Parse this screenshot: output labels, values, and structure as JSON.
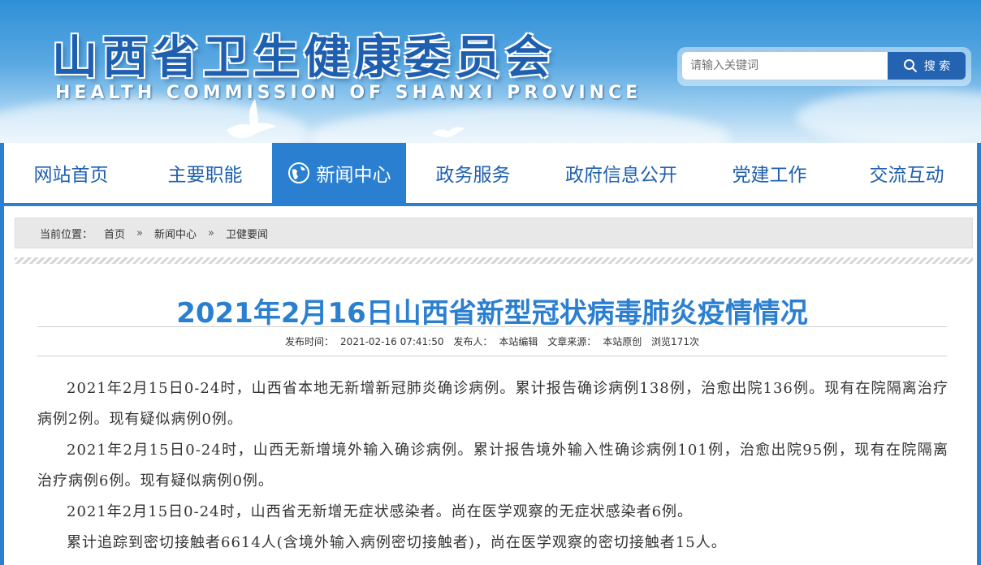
{
  "header": {
    "title": "山西省卫生健康委员会",
    "subtitle": "HEALTH COMMISSION OF SHANXI PROVINCE",
    "search_placeholder": "请输入关键词",
    "search_button": "搜 索"
  },
  "nav": {
    "items": [
      {
        "label": "网站首页"
      },
      {
        "label": "主要职能"
      },
      {
        "label": "新闻中心"
      },
      {
        "label": "政务服务"
      },
      {
        "label": "政府信息公开"
      },
      {
        "label": "党建工作"
      },
      {
        "label": "交流互动"
      }
    ]
  },
  "breadcrumb": {
    "prefix": "当前位置：",
    "items": [
      "首页",
      "新闻中心",
      "卫健要闻"
    ],
    "separator": "»"
  },
  "article": {
    "title": "2021年2月16日山西省新型冠状病毒肺炎疫情情况",
    "meta": {
      "publish_time_label": "发布时间：",
      "publish_time": "2021-02-16 07:41:50",
      "publisher_label": "发布人：",
      "publisher": "本站编辑",
      "source_label": "文章来源：",
      "source": "本站原创",
      "views": "浏览171次"
    },
    "paragraphs": [
      "2021年2月15日0-24时，山西省本地无新增新冠肺炎确诊病例。累计报告确诊病例138例，治愈出院136例。现有在院隔离治疗病例2例。现有疑似病例0例。",
      "2021年2月15日0-24时，山西无新增境外输入确诊病例。累计报告境外输入性确诊病例101例，治愈出院95例，现有在院隔离治疗病例6例。现有疑似病例0例。",
      "2021年2月15日0-24时，山西省无新增无症状感染者。尚在医学观察的无症状感染者6例。",
      "累计追踪到密切接触者6614人(含境外输入病例密切接触者)，尚在医学观察的密切接触者15人。"
    ]
  },
  "colors": {
    "brand_blue": "#2b7fd0",
    "title_blue": "#1f5fb0",
    "search_button": "#2363b1"
  }
}
